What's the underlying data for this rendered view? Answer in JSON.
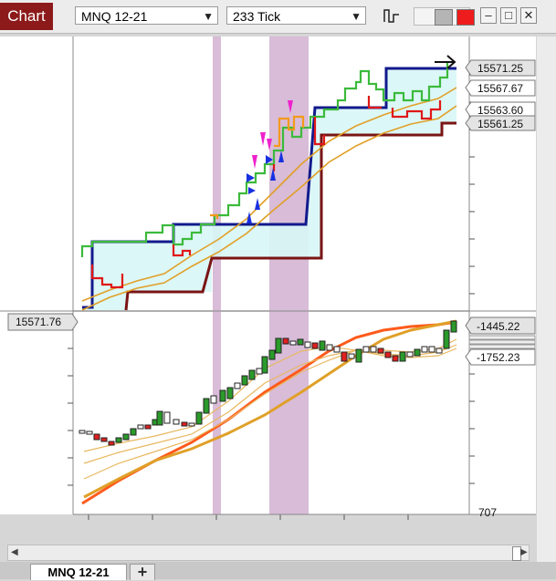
{
  "toolbar": {
    "chart_label": "Chart",
    "instrument": "MNQ 12-21",
    "interval": "233 Tick"
  },
  "tabs": {
    "active": "MNQ 12-21",
    "add": "+"
  },
  "panels": {
    "price": {
      "labels": [
        "15571.25",
        "15567.67",
        "15563.60",
        "15561.25"
      ],
      "crosshair_price": "15571.76"
    },
    "indicator": {
      "labels": [
        "-1445.22",
        "-1752.23"
      ],
      "cut_label": "707"
    }
  },
  "colors": {
    "brand": "#8c1a1a",
    "highlight_band": "#d8bcd8",
    "upper_channel": "#111a8c",
    "lower_channel": "#7a1414",
    "channel_fill": "#d8f6f6",
    "green_line": "#3cba3c",
    "red_line": "#e01818",
    "orange_line": "#f39a1c",
    "ema_fast": "#ff5a1c",
    "ema_slow": "#e0a028"
  }
}
